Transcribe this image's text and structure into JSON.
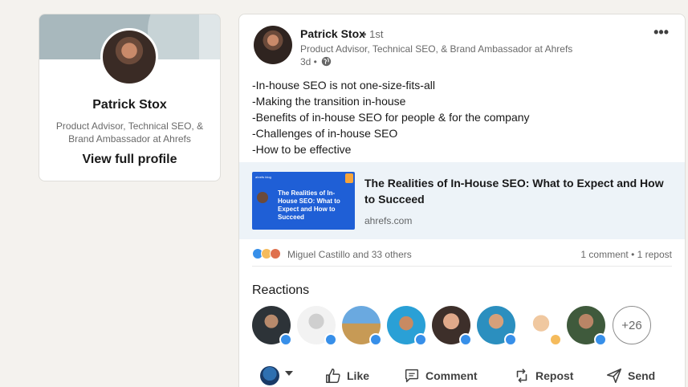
{
  "profile": {
    "name": "Patrick Stox",
    "headline": "Product Advisor, Technical SEO, & Brand Ambassador at Ahrefs",
    "view_profile": "View full profile"
  },
  "post": {
    "author": {
      "name": "Patrick Stox",
      "degree": "• 1st",
      "headline": "Product Advisor, Technical SEO, & Brand Ambassador at Ahrefs",
      "time": "3d •"
    },
    "more_icon": "•••",
    "body_lines": [
      "-In-house SEO is not one-size-fits-all",
      "-Making the transition in-house",
      "-Benefits of in-house SEO for people & for the company",
      "-Challenges of in-house SEO",
      "-How to be effective"
    ],
    "link": {
      "thumb_brand": "ahrefs blog",
      "thumb_title": "The Realities of In-House SEO: What to Expect and How to Succeed",
      "title": "The Realities of In-House SEO: What to Expect and How to Succeed",
      "domain": "ahrefs.com"
    },
    "social": {
      "reactors": "Miguel Castillo and 33 others",
      "counts": "1 comment • 1 repost"
    },
    "reactions": {
      "heading": "Reactions",
      "more": "+26"
    },
    "actions": {
      "like": "Like",
      "comment": "Comment",
      "repost": "Repost",
      "send": "Send"
    }
  },
  "colors": {
    "background": "#f4f2ee",
    "like_blue": "#378fe9",
    "preview_bg": "#edf3f8"
  }
}
